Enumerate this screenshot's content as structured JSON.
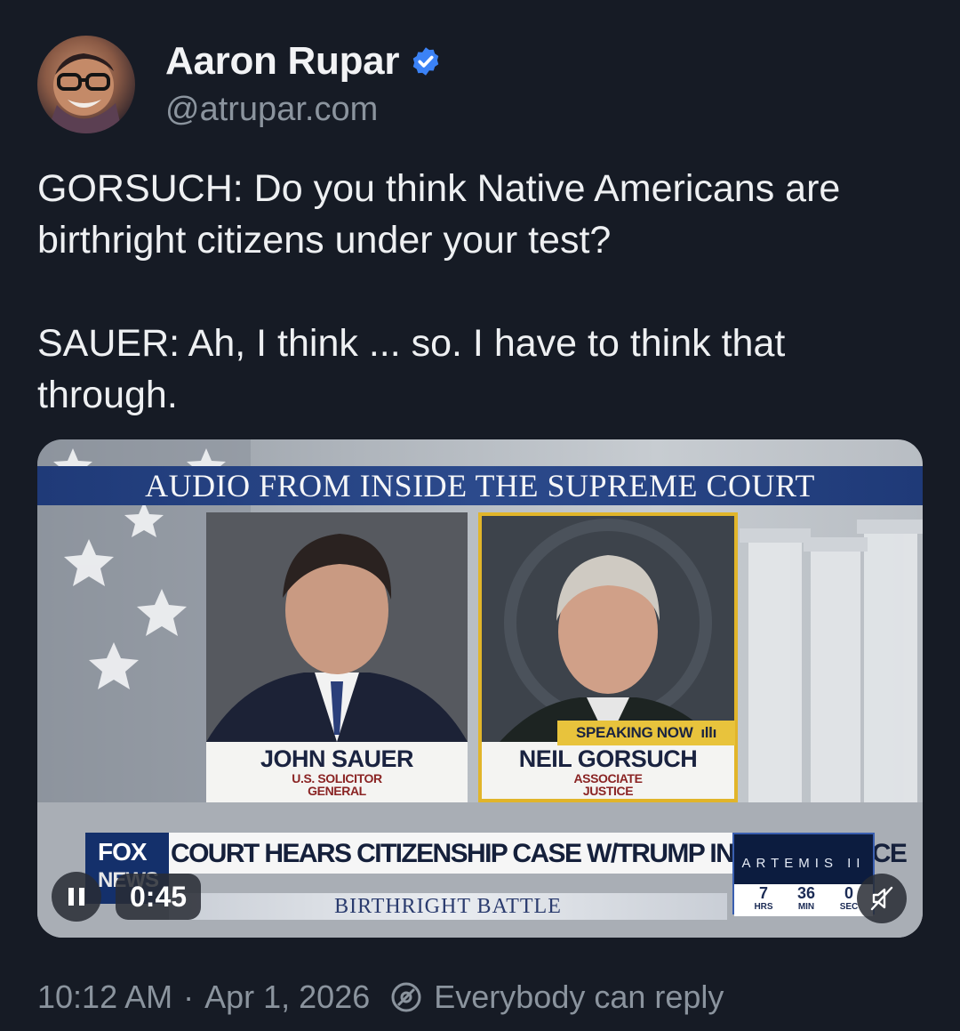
{
  "author": {
    "name": "Aaron Rupar",
    "handle": "@atrupar.com",
    "verified_color": "#3b82f6"
  },
  "post": {
    "text": "GORSUCH: Do you think Native Americans are birthright citizens under your test?\n\nSAUER: Ah, I think ... so. I have to think that through."
  },
  "video": {
    "banner": "AUDIO FROM INSIDE THE SUPREME COURT",
    "left_card": {
      "name": "JOHN SAUER",
      "role_line1": "U.S. SOLICITOR",
      "role_line2": "GENERAL"
    },
    "right_card": {
      "speaking_label": "SPEAKING NOW",
      "name": "NEIL GORSUCH",
      "role_line1": "ASSOCIATE",
      "role_line2": "JUSTICE"
    },
    "network": {
      "line1": "FOX",
      "line2": "NEWS"
    },
    "chyron_main": "COURT HEARS CITIZENSHIP CASE W/TRUMP IN ATTENDANCE",
    "chyron_sub": "BIRTHRIGHT BATTLE",
    "countdown": {
      "title": "ARTEMIS II",
      "hours": "7",
      "hours_label": "HRS",
      "minutes": "36",
      "minutes_label": "MIN",
      "seconds": "0",
      "seconds_label": "SEC"
    },
    "controls": {
      "time": "0:45",
      "pause_icon": "pause-icon",
      "mute_icon": "muted-speaker-icon"
    }
  },
  "footer": {
    "time": "10:12 AM",
    "separator": "·",
    "date": "Apr 1, 2026",
    "reply_setting": "Everybody can reply",
    "reply_icon": "reply-settings-icon"
  }
}
